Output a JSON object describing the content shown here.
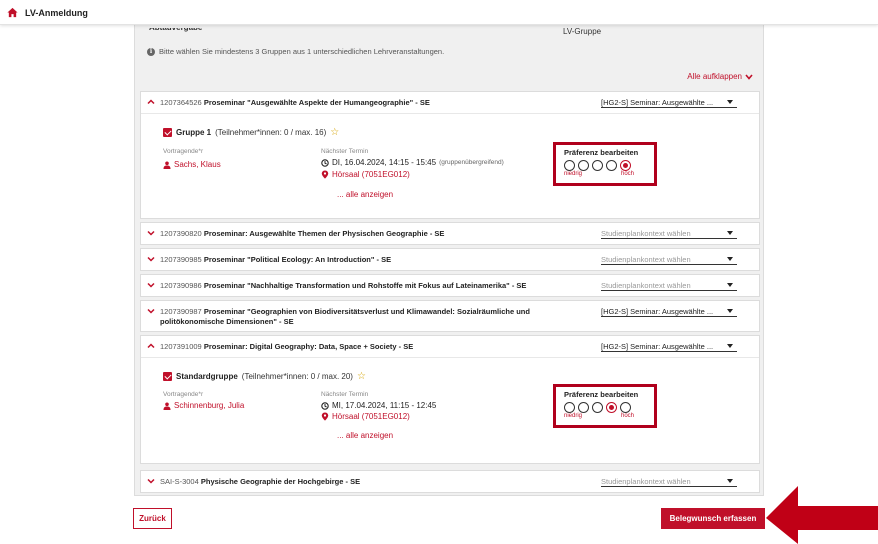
{
  "topbar": {
    "title": "LV-Anmeldung"
  },
  "panel": {
    "cut_label": "Abtauvergabe",
    "column_header": "LV-Gruppe",
    "info": "Bitte wählen Sie mindestens 3 Gruppen aus 1 unterschiedlichen Lehrveranstaltungen.",
    "expand_all": "Alle aufklappen"
  },
  "courses": [
    {
      "number": "1207364526",
      "title": "Proseminar \"Ausgewählte Aspekte der Humangeographie\" - SE",
      "select": "[HG2-S] Seminar: Ausgewählte ..."
    },
    {
      "number": "1207390820",
      "title": "Proseminar: Ausgewählte Themen der Physischen Geographie - SE",
      "select": "Studienplankontext wählen"
    },
    {
      "number": "1207390985",
      "title": "Proseminar \"Political Ecology: An Introduction\" - SE",
      "select": "Studienplankontext wählen"
    },
    {
      "number": "1207390986",
      "title": "Proseminar \"Nachhaltige Transformation und Rohstoffe mit Fokus auf Lateinamerika\" - SE",
      "select": "Studienplankontext wählen"
    },
    {
      "number": "1207390987",
      "title": "Proseminar \"Geographien von Biodiversitätsverlust und Klimawandel: Sozialräumliche und politökonomische Dimensionen\" - SE",
      "select": "[HG2-S] Seminar: Ausgewählte ..."
    },
    {
      "number": "1207391009",
      "title": "Proseminar: Digital Geography: Data, Space + Society - SE",
      "select": "[HG2-S] Seminar: Ausgewählte ..."
    },
    {
      "number": "SAI-S-3004",
      "title": "Physische Geographie der Hochgebirge - SE",
      "select": "Studienplankontext wählen"
    }
  ],
  "groups": [
    {
      "name": "Gruppe 1",
      "capacity": "(Teilnehmer*innen: 0 / max. 16)",
      "lecturer_label": "Vortragende*r",
      "lecturer": "Sachs, Klaus",
      "next_label": "Nächster Termin",
      "next_date": "DI, 16.04.2024, 14:15 - 15:45",
      "next_note": "(gruppenübergreifend)",
      "room": "Hörsaal (7051EG012)",
      "show_all": "... alle anzeigen",
      "preference": {
        "title": "Präferenz bearbeiten",
        "low": "niedrig",
        "high": "hoch",
        "selected": 5,
        "max": 5
      }
    },
    {
      "name": "Standardgruppe",
      "capacity": "(Teilnehmer*innen: 0 / max. 20)",
      "lecturer_label": "Vortragende*r",
      "lecturer": "Schinnenburg, Julia",
      "next_label": "Nächster Termin",
      "next_date": "MI, 17.04.2024, 11:15 - 12:45",
      "next_note": "",
      "room": "Hörsaal (7051EG012)",
      "show_all": "... alle anzeigen",
      "preference": {
        "title": "Präferenz bearbeiten",
        "low": "niedrig",
        "high": "hoch",
        "selected": 4,
        "max": 5
      }
    }
  ],
  "buttons": {
    "back": "Zurück",
    "submit": "Belegwunsch erfassen"
  },
  "colors": {
    "accent": "#c0102a",
    "annotation": "#b0001c"
  }
}
